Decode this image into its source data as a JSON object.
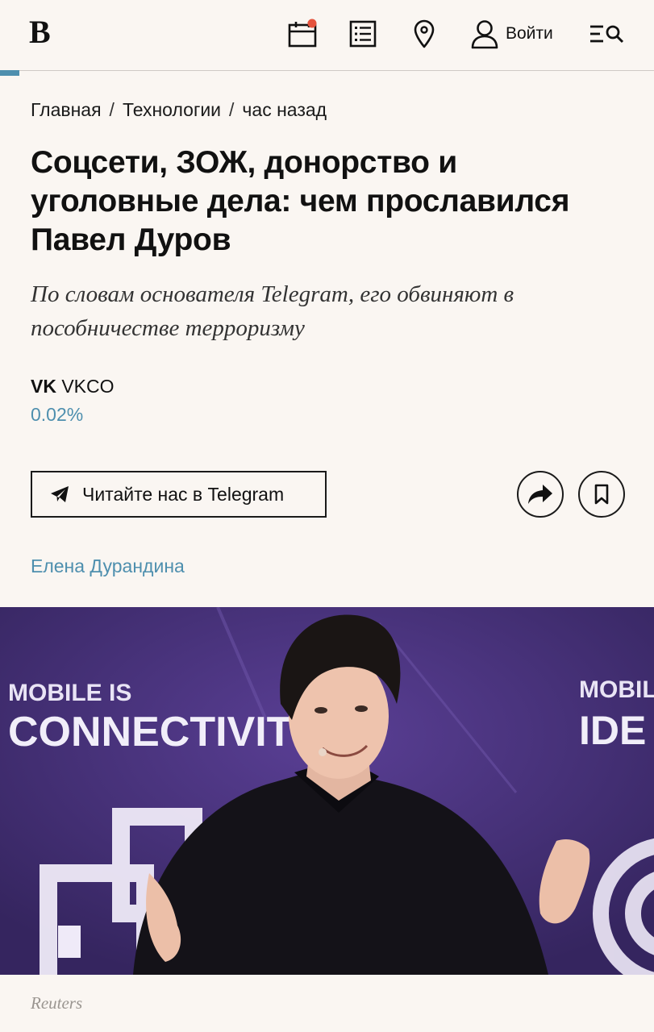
{
  "header": {
    "logo": "В",
    "login_label": "Войти",
    "icons": [
      "calendar-icon",
      "list-icon",
      "location-pin-icon",
      "user-icon",
      "menu-search-icon"
    ],
    "notification_dot_color": "#e5533d"
  },
  "reading_progress": 0.03,
  "breadcrumb": {
    "home": "Главная",
    "section": "Технологии",
    "time": "час назад",
    "separator": "/"
  },
  "article": {
    "title": "Соцсети, ЗОЖ, донорство и уголовные дела: чем прославился Павел Дуров",
    "subtitle": "По словам основателя Telegram, его обвиняют в пособничестве терроризму",
    "ticker": {
      "name": "VK",
      "symbol": "VKCO",
      "change": "0.02%"
    },
    "telegram_button_label": "Читайте нас в Telegram",
    "author": "Елена Дурандина"
  },
  "photo": {
    "banner_left_line1": "MOBILE IS",
    "banner_left_line2": "CONNECTIVITY",
    "banner_right_line1": "MOBILE",
    "banner_right_line2": "IDE",
    "caption": "Reuters"
  },
  "colors": {
    "background": "#faf6f2",
    "accent": "#4e8fae",
    "photo_bg": "#4a3380"
  }
}
